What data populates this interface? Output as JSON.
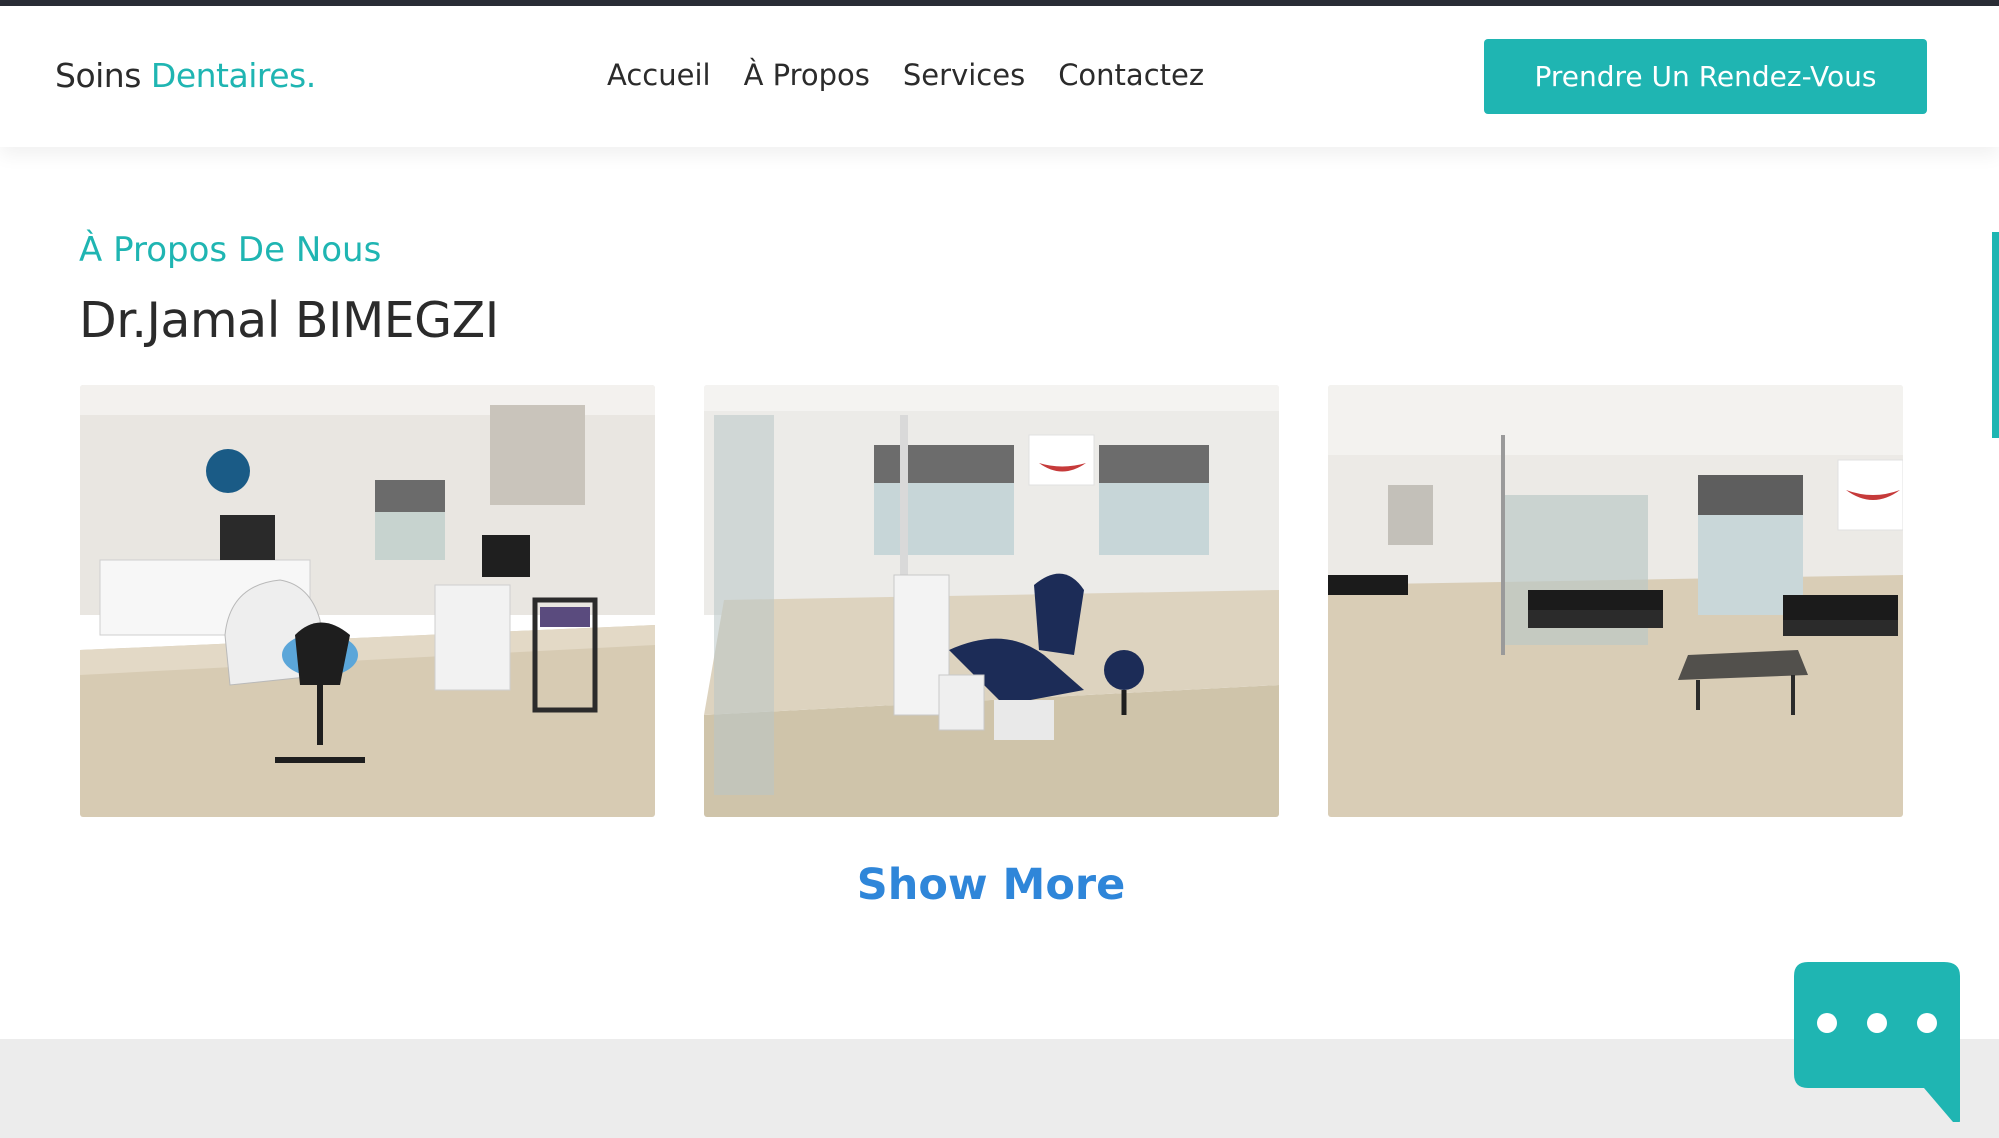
{
  "header": {
    "logo_prefix": "Soins",
    "logo_accent": "Dentaires.",
    "nav": [
      "Accueil",
      "À Propos",
      "Services",
      "Contactez"
    ],
    "cta_label": "Prendre Un Rendez-Vous"
  },
  "about": {
    "eyebrow": "À Propos De Nous",
    "title": "Dr.Jamal BIMEGZI",
    "show_more": "Show More"
  },
  "colors": {
    "accent": "#1fb5b2",
    "link_blue": "#2f86d9",
    "text": "#2b2b2b"
  },
  "icons": {
    "chat": "chat-bubble-icon"
  }
}
